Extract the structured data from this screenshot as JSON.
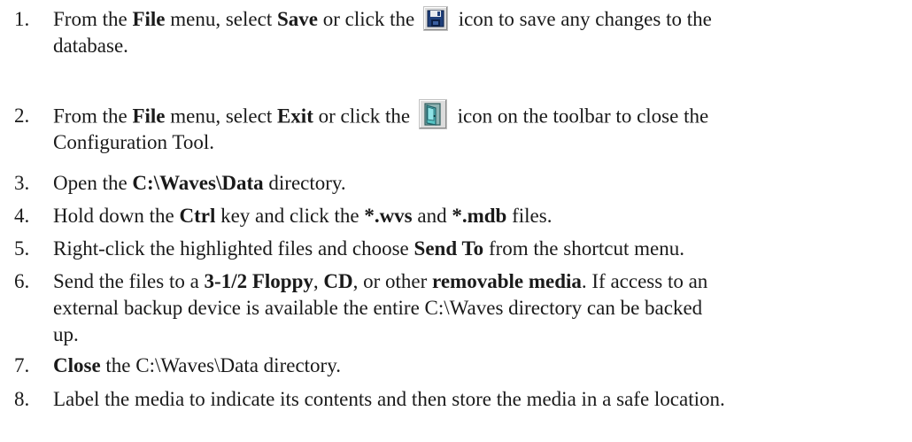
{
  "steps": [
    {
      "num": "1.",
      "lines": [
        [
          {
            "t": "From the "
          },
          {
            "t": "File",
            "b": true
          },
          {
            "t": " menu, select "
          },
          {
            "t": "Save",
            "b": true
          },
          {
            "t": " or click the "
          },
          {
            "icon": "save-disk-icon"
          },
          {
            "t": " icon to save any changes to the"
          }
        ],
        [
          {
            "t": "database."
          }
        ]
      ]
    },
    {
      "num": "2.",
      "lines": [
        [
          {
            "t": "From the "
          },
          {
            "t": "File",
            "b": true
          },
          {
            "t": " menu, select "
          },
          {
            "t": "Exit",
            "b": true
          },
          {
            "t": " or click the "
          },
          {
            "icon": "exit-door-icon"
          },
          {
            "t": " icon on the toolbar to close the"
          }
        ],
        [
          {
            "t": "Configuration Tool."
          }
        ]
      ]
    },
    {
      "num": "3.",
      "lines": [
        [
          {
            "t": "Open the "
          },
          {
            "t": "C:\\Waves\\Data",
            "b": true
          },
          {
            "t": " directory."
          }
        ]
      ]
    },
    {
      "num": "4.",
      "lines": [
        [
          {
            "t": "Hold down the "
          },
          {
            "t": "Ctrl",
            "b": true
          },
          {
            "t": " key and click the "
          },
          {
            "t": "*.wvs",
            "b": true
          },
          {
            "t": " and "
          },
          {
            "t": "*.mdb",
            "b": true
          },
          {
            "t": " files."
          }
        ]
      ]
    },
    {
      "num": "5.",
      "lines": [
        [
          {
            "t": "Right-click the highlighted files and choose "
          },
          {
            "t": "Send To",
            "b": true
          },
          {
            "t": " from the shortcut menu."
          }
        ]
      ]
    },
    {
      "num": "6.",
      "lines": [
        [
          {
            "t": "Send the files to a "
          },
          {
            "t": "3-1/2 Floppy",
            "b": true
          },
          {
            "t": ", "
          },
          {
            "t": "CD",
            "b": true
          },
          {
            "t": ", or other "
          },
          {
            "t": "removable media",
            "b": true
          },
          {
            "t": ". If access to an"
          }
        ],
        [
          {
            "t": "external backup device is available the entire C:\\Waves directory can be backed"
          }
        ],
        [
          {
            "t": "up."
          }
        ]
      ]
    },
    {
      "num": "7.",
      "lines": [
        [
          {
            "t": "Close",
            "b": true
          },
          {
            "t": " the C:\\Waves\\Data directory."
          }
        ]
      ]
    },
    {
      "num": "8.",
      "lines": [
        [
          {
            "t": "Label the media to indicate its contents and then store the media in a safe location."
          }
        ]
      ]
    }
  ]
}
